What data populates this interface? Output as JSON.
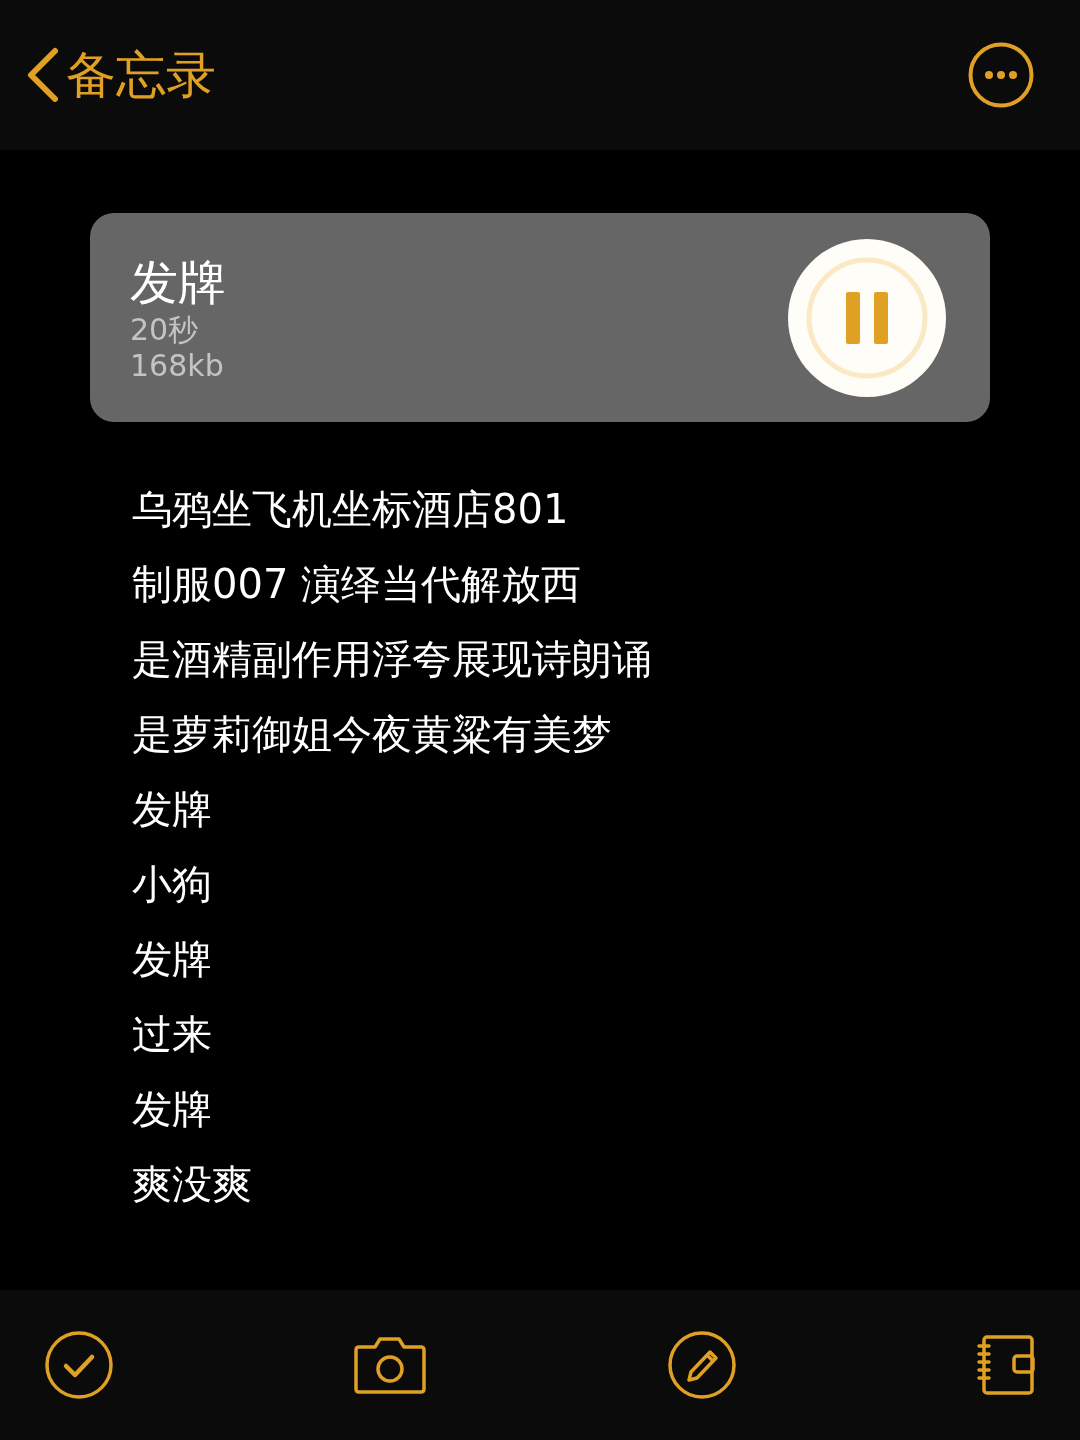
{
  "header": {
    "back_label": "备忘录"
  },
  "recording": {
    "title": "发牌",
    "duration": "20秒",
    "size": "168kb",
    "playing": true
  },
  "lines": [
    "乌鸦坐飞机坐标酒店801",
    "制服007 演绎当代解放西",
    "是酒精副作用浮夸展现诗朗诵",
    "是萝莉御姐今夜黄粱有美梦",
    "发牌",
    "小狗",
    "发牌",
    "过来",
    "发牌",
    "爽没爽"
  ],
  "toolbar": [
    {
      "kind": "check"
    },
    {
      "kind": "camera"
    },
    {
      "kind": "compose"
    },
    {
      "kind": "notebook"
    }
  ]
}
